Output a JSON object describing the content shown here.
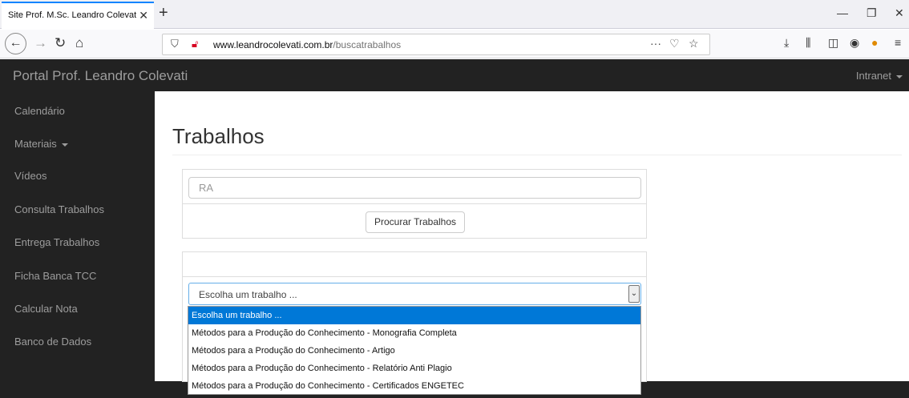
{
  "browser": {
    "tab_title": "Site Prof. M.Sc. Leandro Colevati d",
    "tab_close": "✕",
    "new_tab": "+",
    "url_host": "www.leandrocolevati.com.br",
    "url_path": "/buscatrabalhos",
    "url_more": "···"
  },
  "portal": {
    "brand": "Portal Prof. Leandro Colevati",
    "intranet": "Intranet"
  },
  "sidebar": {
    "items": [
      {
        "label": "Calendário"
      },
      {
        "label": "Materiais"
      },
      {
        "label": "Vídeos"
      },
      {
        "label": "Consulta Trabalhos"
      },
      {
        "label": "Entrega Trabalhos"
      },
      {
        "label": "Ficha Banca TCC"
      },
      {
        "label": "Calcular Nota"
      },
      {
        "label": "Banco de Dados"
      }
    ]
  },
  "main": {
    "title": "Trabalhos",
    "ra_placeholder": "RA",
    "search_button": "Procurar Trabalhos",
    "select_value": "Escolha um trabalho ...",
    "select_options": [
      "Escolha um trabalho ...",
      "Métodos para a Produção do Conhecimento - Monografia Completa",
      "Métodos para a Produção do Conhecimento - Artigo",
      "Métodos para a Produção do Conhecimento - Relatório Anti Plagio",
      "Métodos para a Produção do Conhecimento - Certificados ENGETEC"
    ]
  },
  "colors": {
    "dark": "#222222",
    "muted_text": "#9d9d9d",
    "selection": "#0078d7"
  }
}
